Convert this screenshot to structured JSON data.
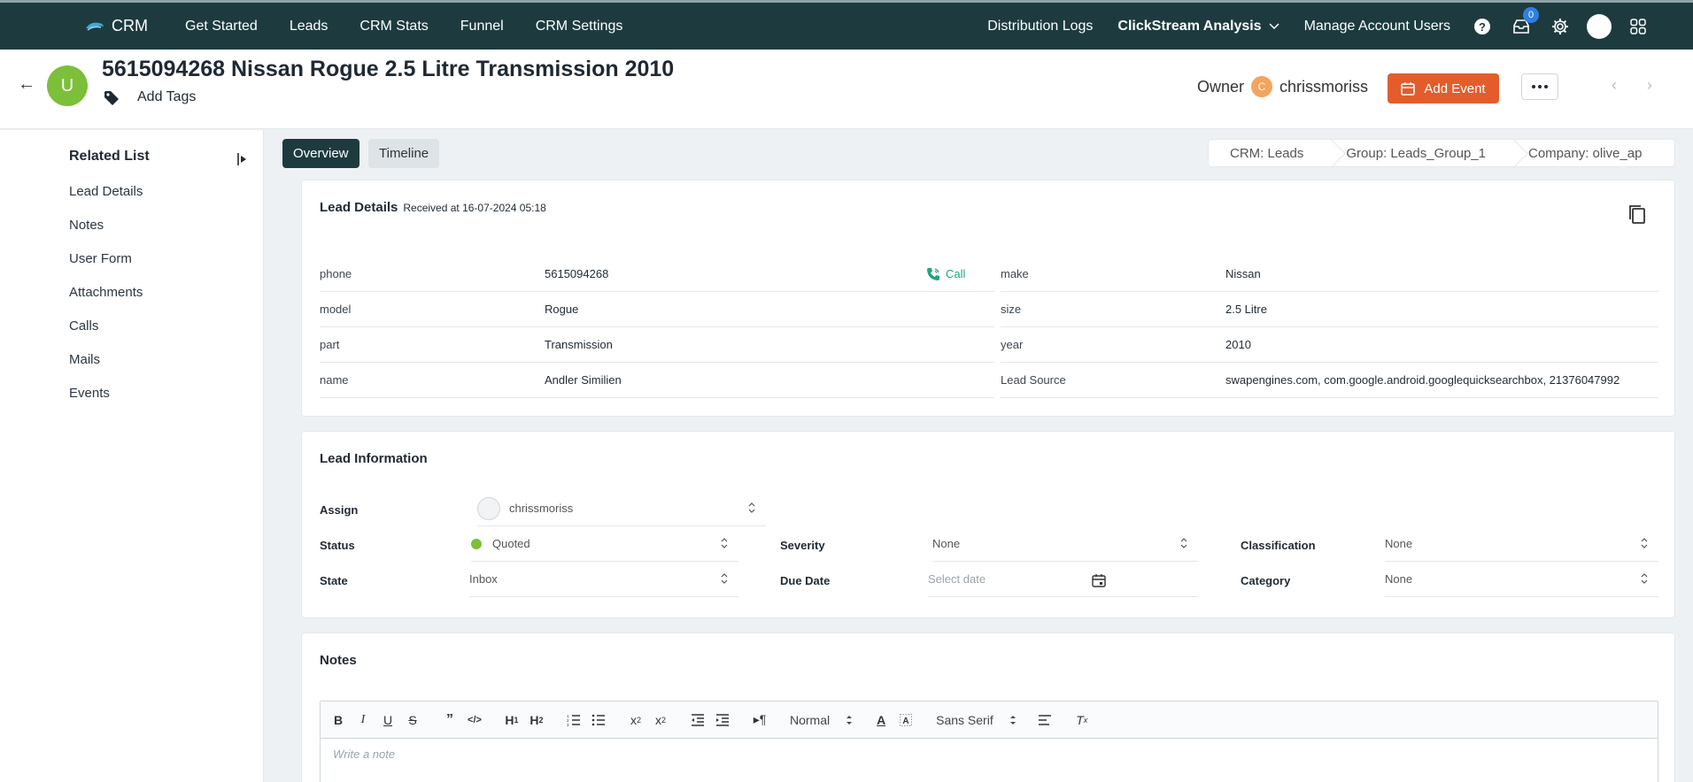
{
  "nav": {
    "brand": "CRM",
    "links": [
      "Get Started",
      "Leads",
      "CRM Stats",
      "Funnel",
      "CRM Settings"
    ],
    "right_links": {
      "distribution_logs": "Distribution Logs",
      "clickstream": "ClickStream Analysis",
      "manage_users": "Manage Account Users"
    },
    "inbox_count": "0"
  },
  "header": {
    "avatar_letter": "U",
    "title": "5615094268 Nissan Rogue 2.5 Litre Transmission 2010",
    "add_tags": "Add Tags",
    "owner_label": "Owner",
    "owner_initial": "C",
    "owner_name": "chrissmoriss",
    "add_event": "Add Event"
  },
  "sidebar": {
    "title": "Related List",
    "items": [
      "Lead Details",
      "Notes",
      "User Form",
      "Attachments",
      "Calls",
      "Mails",
      "Events"
    ]
  },
  "tabs": [
    "Overview",
    "Timeline"
  ],
  "breadcrumbs": [
    "CRM: Leads",
    "Group: Leads_Group_1",
    "Company: olive_ap"
  ],
  "lead_details": {
    "title": "Lead Details",
    "received": "Received at 16-07-2024 05:18",
    "call_label": "Call",
    "left": [
      {
        "label": "phone",
        "value": "5615094268"
      },
      {
        "label": "model",
        "value": "Rogue"
      },
      {
        "label": "part",
        "value": "Transmission"
      },
      {
        "label": "name",
        "value": "Andler Similien"
      }
    ],
    "right": [
      {
        "label": "make",
        "value": "Nissan"
      },
      {
        "label": "size",
        "value": "2.5 Litre"
      },
      {
        "label": "year",
        "value": "2010"
      },
      {
        "label": "Lead Source",
        "value": "swapengines.com, com.google.android.googlequicksearchbox, 21376047992"
      }
    ]
  },
  "lead_info": {
    "title": "Lead Information",
    "assign_label": "Assign",
    "assign_value": "chrissmoriss",
    "status_label": "Status",
    "status_value": "Quoted",
    "severity_label": "Severity",
    "severity_value": "None",
    "classification_label": "Classification",
    "classification_value": "None",
    "state_label": "State",
    "state_value": "Inbox",
    "due_label": "Due Date",
    "due_placeholder": "Select date",
    "category_label": "Category",
    "category_value": "None",
    "status_color": "#7cbf3b"
  },
  "notes": {
    "title": "Notes",
    "font_size_option": "Normal",
    "font_family_option": "Sans Serif",
    "placeholder": "Write a note"
  },
  "colors": {
    "nav_bg": "#1d3b3f",
    "accent_orange": "#e35d2c",
    "call_green": "#21a67a"
  }
}
